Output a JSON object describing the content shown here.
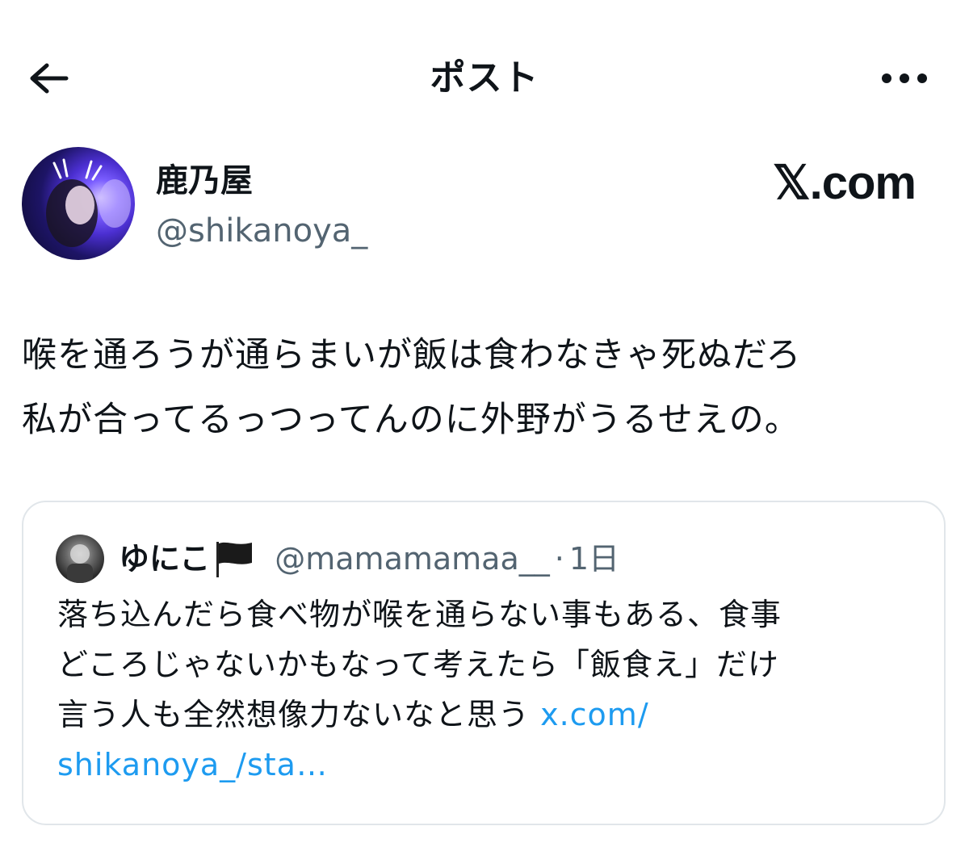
{
  "header": {
    "title": "ポスト",
    "back_icon": "arrow-left-icon",
    "more_icon": "more-horizontal-icon"
  },
  "author": {
    "display_name": "鹿乃屋",
    "username": "@shikanoya_"
  },
  "watermark": "𝕏.com",
  "post": {
    "lines": [
      "喉を通ろうが通らまいが飯は食わなきゃ死ぬだろ",
      "私が合ってるっつってんのに外野がうるせえの。"
    ]
  },
  "quote": {
    "display_name": "ゆにこ",
    "flag_icon": "black-flag-icon",
    "username": "@mamamamaa__",
    "separator": "·",
    "time": "1日",
    "lines": [
      "落ち込んだら食べ物が喉を通らない事もある、食事",
      "どころじゃないかもなって考えたら「飯食え」だけ",
      "言う人も全然想像力ないなと思う "
    ],
    "link_part1": "x.com/",
    "link_part2": "shikanoya_/sta…"
  },
  "colors": {
    "text": "#0f1419",
    "secondary": "#536471",
    "link": "#1d9bf0",
    "border": "#e1e6ea"
  }
}
